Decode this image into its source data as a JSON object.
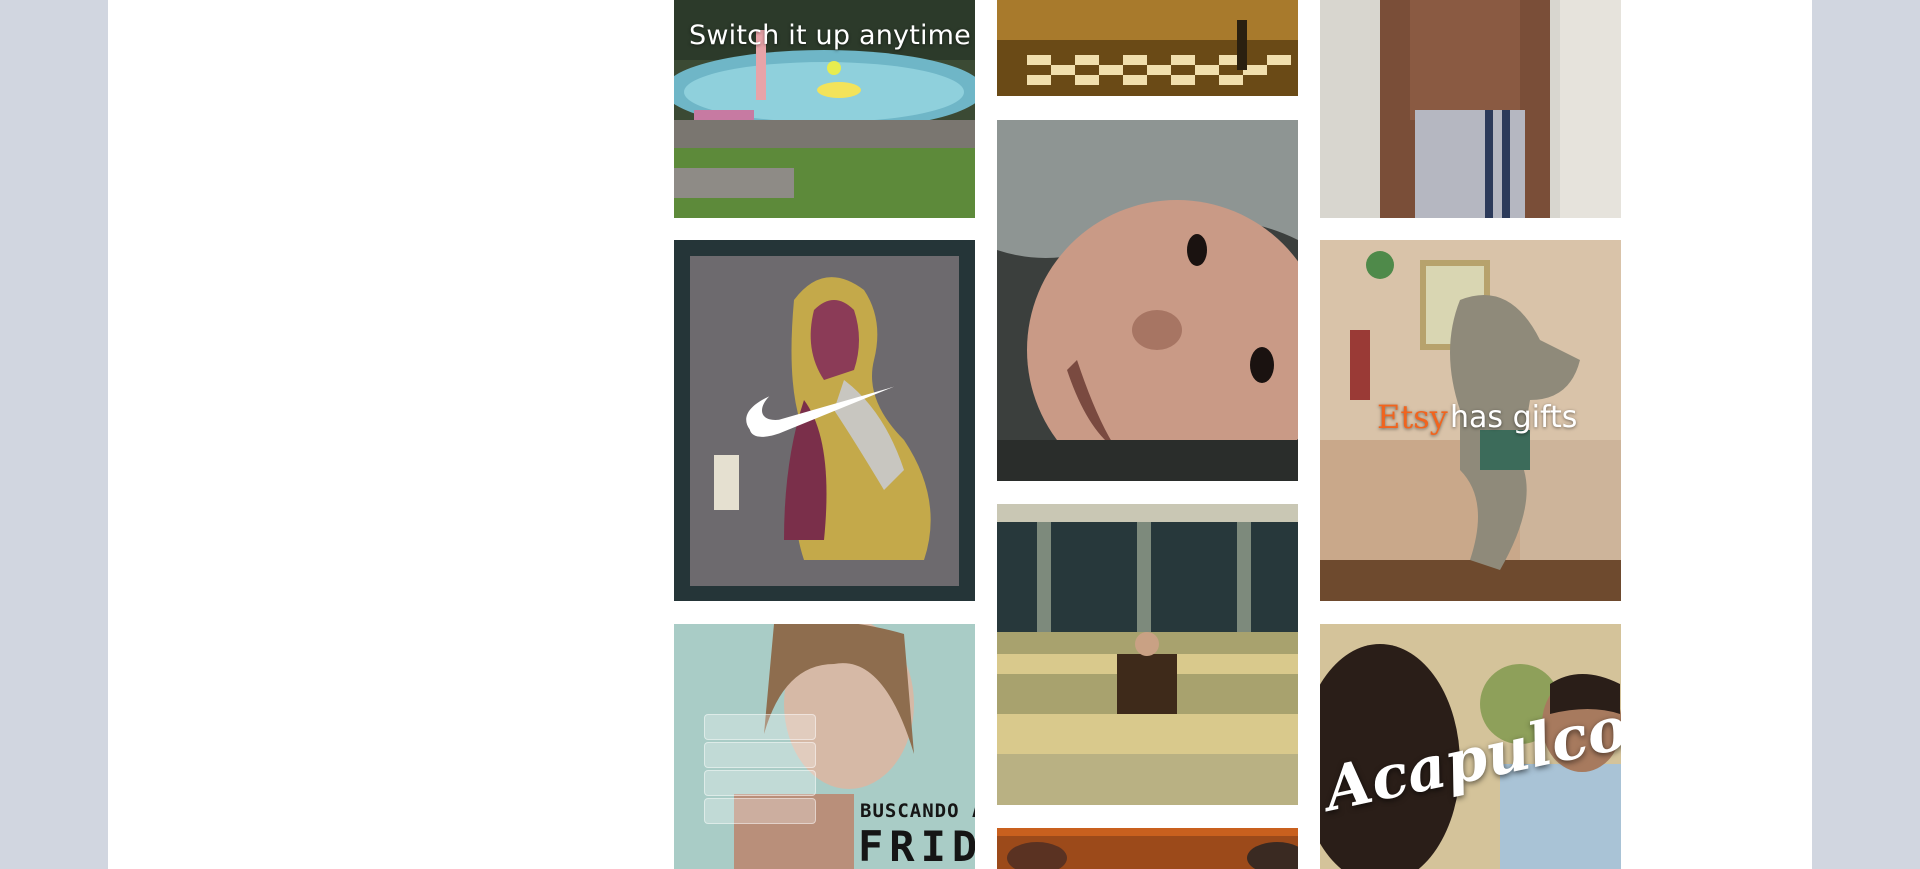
{
  "background_color": "#d1d6e0",
  "content_color": "#ffffff",
  "tiles": {
    "pool": {
      "overlay_text": "Switch it up anytime",
      "icon": "pool-scene"
    },
    "chess": {
      "icon": "chessboard-scene"
    },
    "towel": {
      "icon": "towel-man-scene"
    },
    "nike": {
      "icon": "nike-swoosh"
    },
    "baby": {
      "icon": "baby-face-scene"
    },
    "etsy": {
      "brand": "Etsy",
      "text": "has gifts",
      "brand_color": "#f1641e"
    },
    "office": {
      "icon": "office-cubicles-scene"
    },
    "frida": {
      "line1": "BUSCANDO A",
      "line2": "FRIDA"
    },
    "acapulco": {
      "title": "Acapulco"
    },
    "bottom": {
      "icon": "partial-scene"
    }
  }
}
